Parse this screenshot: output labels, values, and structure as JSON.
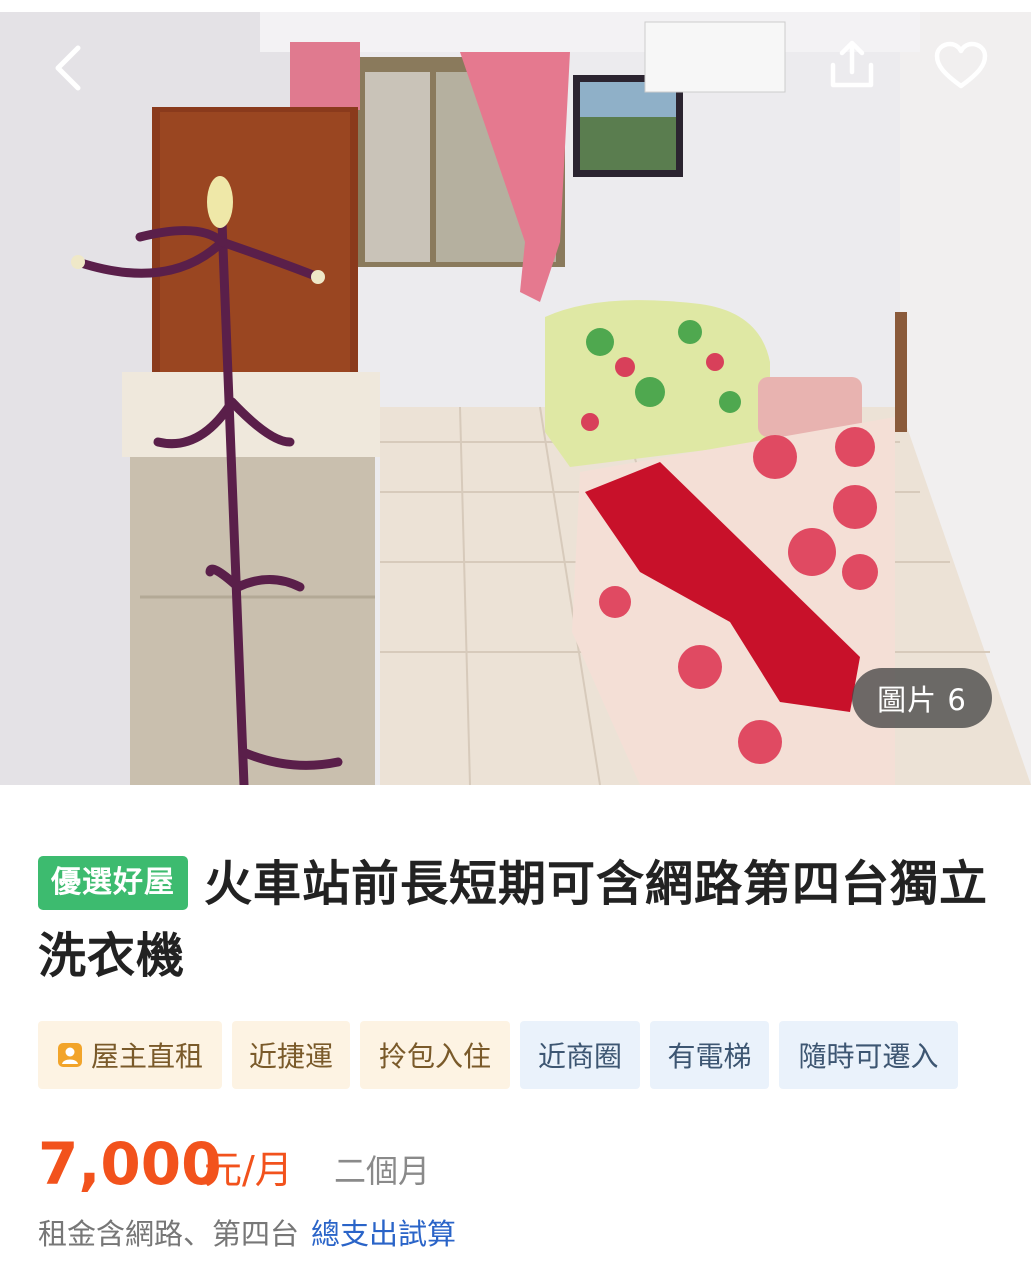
{
  "photo": {
    "counter_label": "圖片 6",
    "back_icon": "chevron-left-icon",
    "share_icon": "share-icon",
    "favorite_icon": "heart-icon"
  },
  "listing": {
    "badge": "優選好屋",
    "title": "火車站前長短期可含網路第四台獨立洗衣機",
    "tags": [
      {
        "label": "屋主直租",
        "style": "warm",
        "icon": "owner-icon"
      },
      {
        "label": "近捷運",
        "style": "warm"
      },
      {
        "label": "拎包入住",
        "style": "warm"
      },
      {
        "label": "近商圈",
        "style": "cool"
      },
      {
        "label": "有電梯",
        "style": "cool"
      },
      {
        "label": "隨時可遷入",
        "style": "cool"
      }
    ],
    "price": "7,000",
    "price_unit": "元/月",
    "term": "二個月",
    "note": "租金含網路、第四台",
    "calc_link": "總支出試算"
  },
  "colors": {
    "badge_green": "#3dbb6f",
    "price_orange": "#f2521c",
    "link_blue": "#2a64c8",
    "tag_warm_bg": "#fdf3e3",
    "tag_cool_bg": "#eaf2fb"
  }
}
